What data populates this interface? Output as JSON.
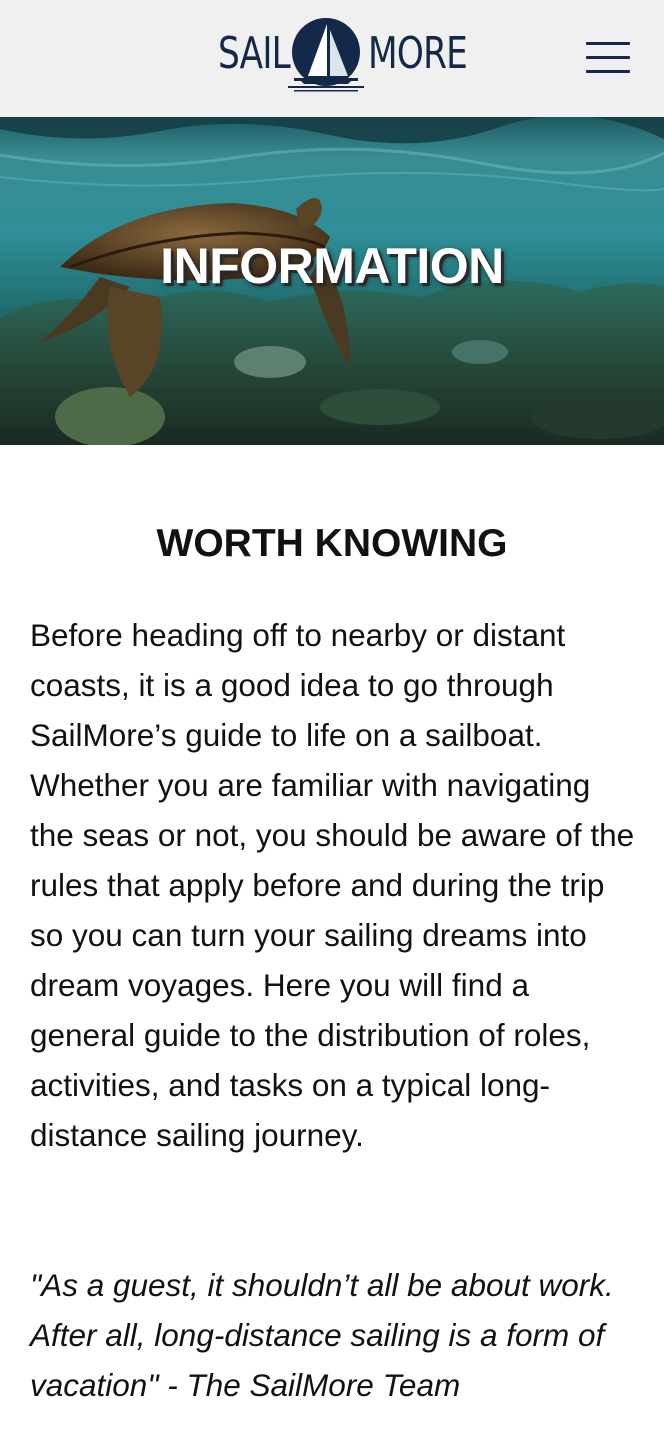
{
  "header": {
    "logo_left": "SAIL",
    "logo_right": "MORE"
  },
  "hero": {
    "title": "INFORMATION"
  },
  "main": {
    "heading": "WORTH KNOWING",
    "paragraph": "Before heading off to nearby or distant coasts, it is a good idea to go through SailMore’s guide to life on a sailboat. Whether you are familiar with navigating the seas or not, you should be aware of the rules that apply before and during the trip so you can turn your sailing dreams into dream voyages. Here you will find a general guide to the distribution of roles, activities, and tasks on a typical long-distance sailing journey.",
    "quote": "\"As a guest, it shouldn’t all be about work. After all, long-distance sailing is a form of vacation\" - The SailMore Team"
  },
  "icons": {
    "logo": "sailboat-icon",
    "menu": "hamburger-menu-icon"
  },
  "colors": {
    "brand_navy": "#14284a",
    "header_bg": "#f0f0f0",
    "text": "#111111"
  }
}
